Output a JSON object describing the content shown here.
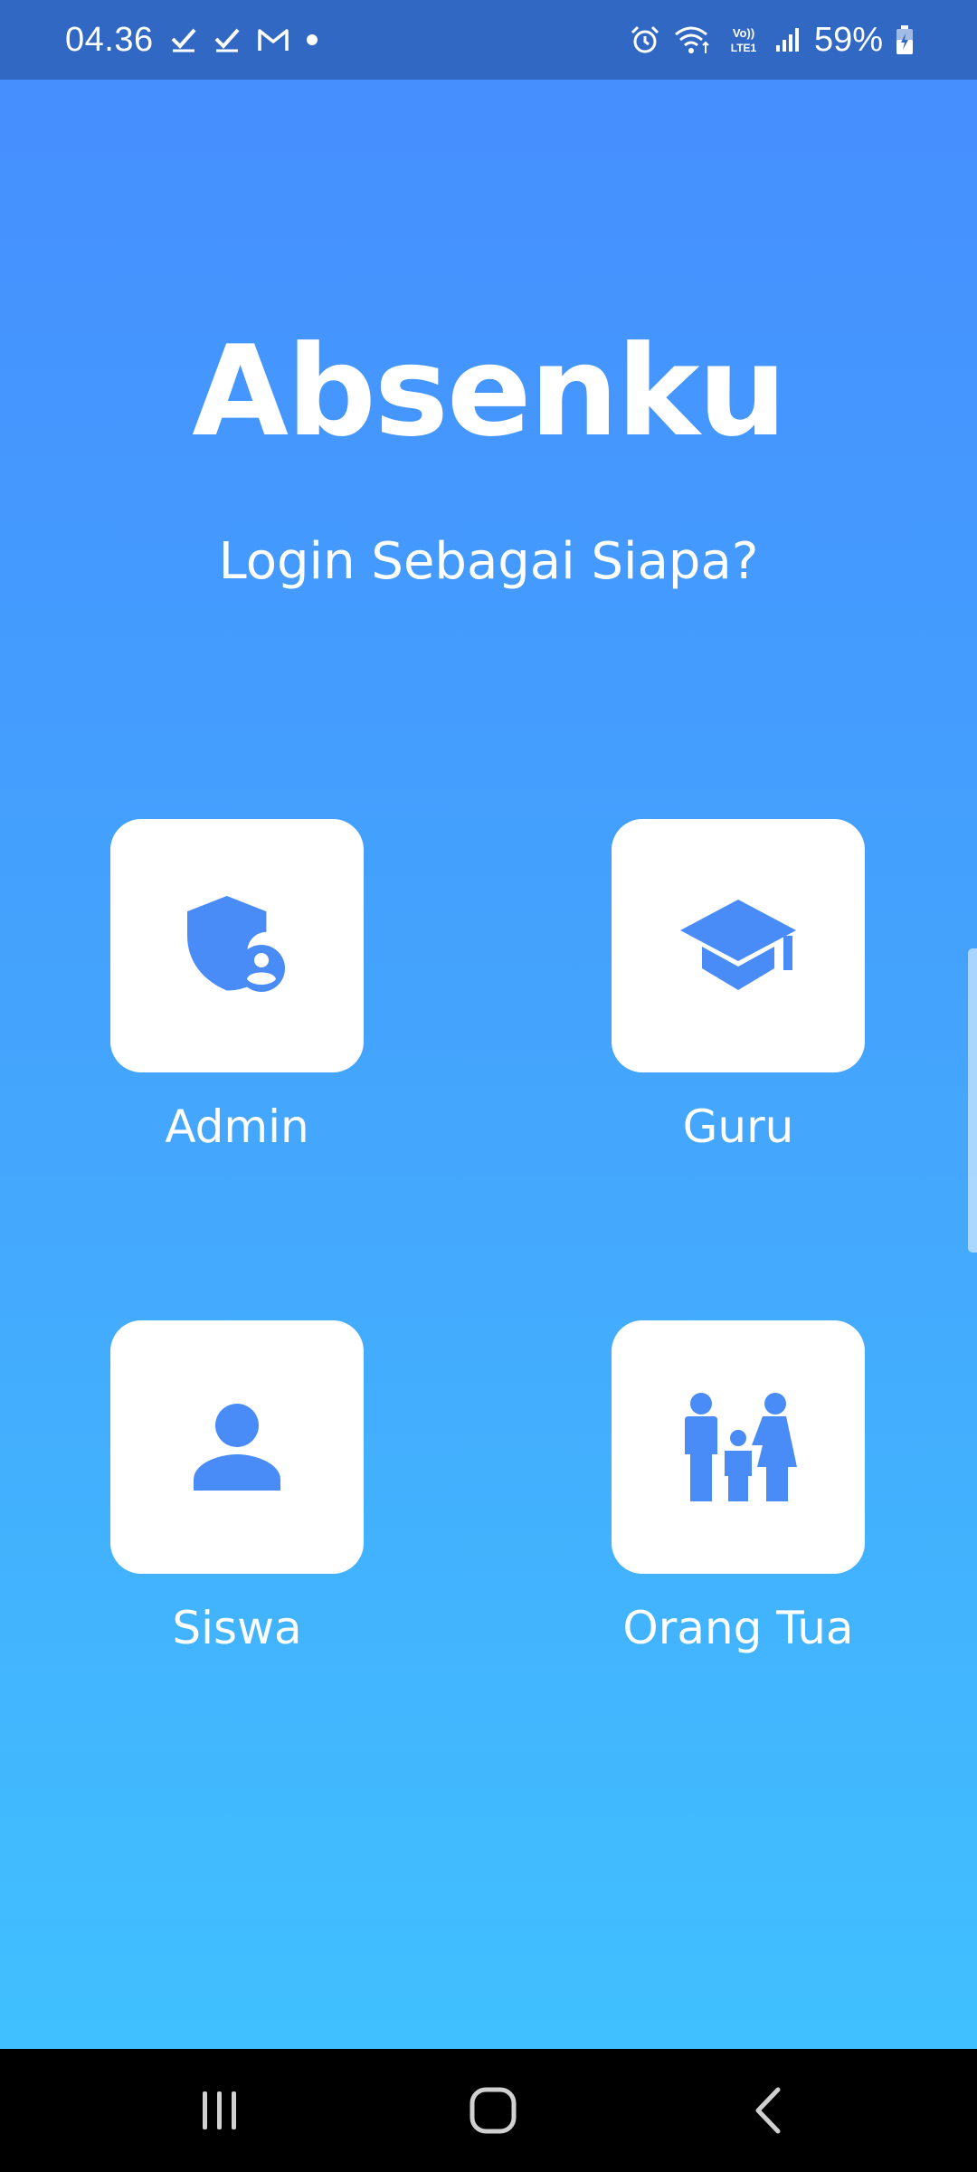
{
  "status_bar": {
    "time": "04.36",
    "battery": "59%",
    "icons": [
      "check-icon",
      "check-icon",
      "gmail-icon",
      "dot-icon",
      "alarm-icon",
      "wifi-icon",
      "volte-icon",
      "signal-icon",
      "battery-charging-icon"
    ],
    "volte_text": "Vo)) LTE1"
  },
  "app": {
    "title": "Absenku",
    "subtitle": "Login Sebagai Siapa?",
    "roles": [
      {
        "label": "Admin",
        "icon": "admin-shield-icon"
      },
      {
        "label": "Guru",
        "icon": "graduation-cap-icon"
      },
      {
        "label": "Siswa",
        "icon": "person-icon"
      },
      {
        "label": "Orang Tua",
        "icon": "family-icon"
      }
    ]
  },
  "colors": {
    "status_bar": "#3168c4",
    "gradient_top": "#458ffe",
    "gradient_bottom": "#40c0fe",
    "icon_accent": "#4a8cf7",
    "card": "#ffffff"
  },
  "nav_bar": {
    "buttons": [
      "recent-apps-icon",
      "home-icon",
      "back-icon"
    ]
  }
}
